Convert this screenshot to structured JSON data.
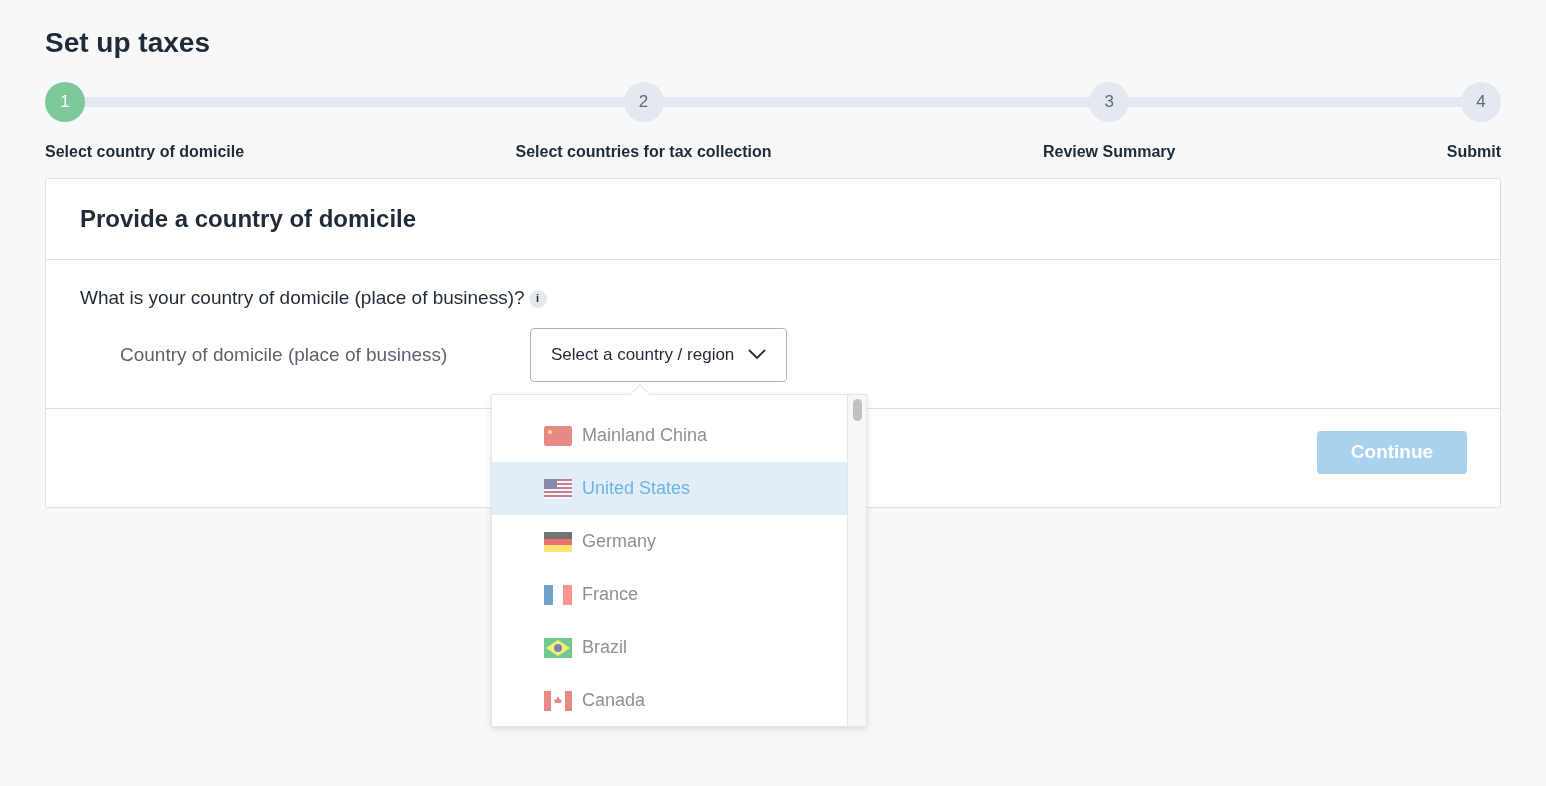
{
  "page_title": "Set up taxes",
  "steps": [
    {
      "number": "1",
      "label": "Select country of domicile",
      "selected": true
    },
    {
      "number": "2",
      "label": "Select countries for tax collection",
      "selected": false
    },
    {
      "number": "3",
      "label": "Review Summary",
      "selected": false
    },
    {
      "number": "4",
      "label": "Submit",
      "selected": false
    }
  ],
  "card": {
    "title": "Provide a country of domicile",
    "question": "What is your country of domicile (place of business)?",
    "info_icon": "i",
    "field_label": "Country of domicile (place of business)",
    "select": {
      "placeholder": "Select a country / region",
      "expanded": true
    },
    "options": [
      {
        "label": "Mainland China",
        "selected": false
      },
      {
        "label": "United States",
        "selected": true
      },
      {
        "label": "Germany",
        "selected": false
      },
      {
        "label": "France",
        "selected": false
      },
      {
        "label": "Brazil",
        "selected": false
      },
      {
        "label": "Canada",
        "selected": false
      }
    ],
    "continue_button": {
      "label": "Continue",
      "disabled": true
    }
  }
}
